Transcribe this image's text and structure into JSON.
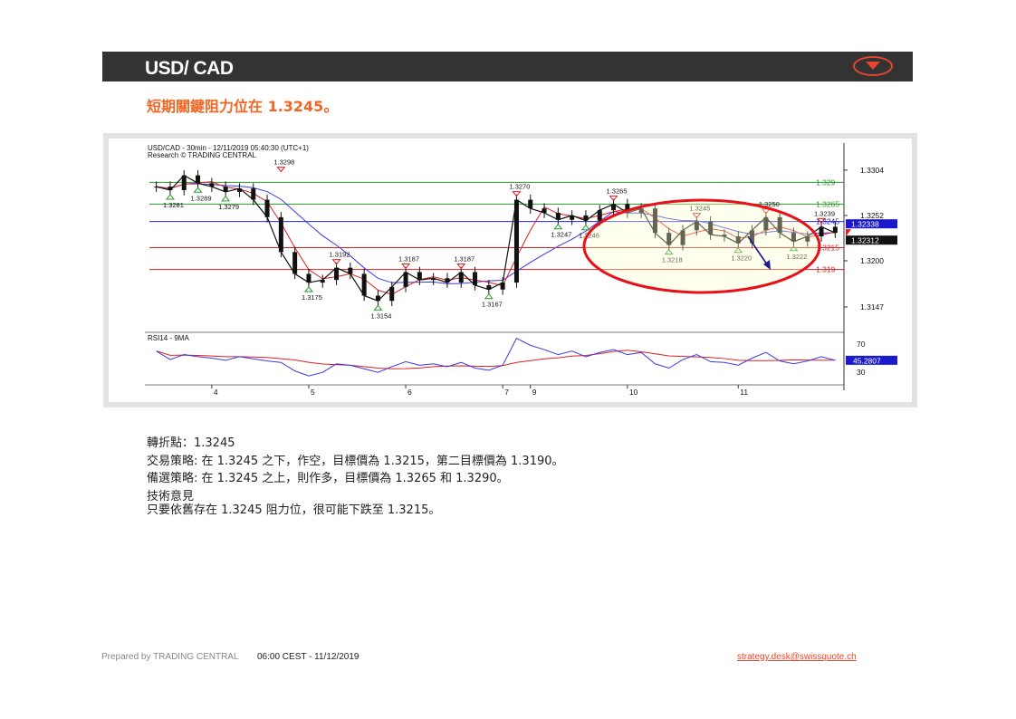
{
  "header": {
    "title": "USD/ CAD"
  },
  "headline": "短期關鍵阻力位在 1.3245。",
  "chart_data": {
    "type": "line",
    "title": "USD/CAD - 30min - 12/11/2019 05:40:30 (UTC+1)",
    "subtitle": "Research © TRADING CENTRAL",
    "x_ticks": [
      "4",
      "5",
      "6",
      "7",
      "9",
      "10",
      "11"
    ],
    "y_ticks": [
      1.3304,
      1.3252,
      1.32,
      1.3147
    ],
    "ylim": [
      1.312,
      1.3335
    ],
    "series": [
      {
        "values": [
          1.3285,
          1.3281,
          1.3298,
          1.3289,
          1.3285,
          1.3279,
          1.3283,
          1.327,
          1.325,
          1.321,
          1.3185,
          1.3175,
          1.3178,
          1.3192,
          1.3185,
          1.316,
          1.3154,
          1.317,
          1.3187,
          1.3178,
          1.318,
          1.3175,
          1.3187,
          1.3172,
          1.3167,
          1.3175,
          1.327,
          1.326,
          1.3255,
          1.3247,
          1.3252,
          1.3246,
          1.3258,
          1.3265,
          1.3255,
          1.326,
          1.3232,
          1.3218,
          1.3235,
          1.3245,
          1.323,
          1.3228,
          1.322,
          1.3235,
          1.325,
          1.3232,
          1.3222,
          1.3228,
          1.3239,
          1.3232
        ]
      }
    ],
    "horizontal_levels": [
      {
        "label": "1.329",
        "value": 1.329,
        "color": "#2a9a2a"
      },
      {
        "label": "1.3265",
        "value": 1.3265,
        "color": "#2a9a2a"
      },
      {
        "label": "1.3245",
        "value": 1.3245,
        "color": "#2626d0"
      },
      {
        "label": "1.3215",
        "value": 1.3215,
        "color": "#e02020"
      },
      {
        "label": "1.319",
        "value": 1.319,
        "color": "#e02020"
      }
    ],
    "current_prices": [
      {
        "label": "1.32338",
        "color": "#1a1acc"
      },
      {
        "label": "1.32312",
        "color": "#111111"
      }
    ],
    "annotations": [
      {
        "text": "1.3298",
        "x": 9,
        "y": 1.3298,
        "kind": "high"
      },
      {
        "text": "1.3281",
        "x": 1,
        "y": 1.3281,
        "kind": "low"
      },
      {
        "text": "1.3289",
        "x": 3,
        "y": 1.3289,
        "kind": "low"
      },
      {
        "text": "1.3279",
        "x": 5,
        "y": 1.3279,
        "kind": "low"
      },
      {
        "text": "1.3192",
        "x": 13,
        "y": 1.3192,
        "kind": "high"
      },
      {
        "text": "1.3187",
        "x": 18,
        "y": 1.3187,
        "kind": "high"
      },
      {
        "text": "1.3175",
        "x": 11,
        "y": 1.3175,
        "kind": "low"
      },
      {
        "text": "1.3154",
        "x": 16,
        "y": 1.3154,
        "kind": "low"
      },
      {
        "text": "1.3187",
        "x": 22,
        "y": 1.3187,
        "kind": "high"
      },
      {
        "text": "1.3167",
        "x": 24,
        "y": 1.3167,
        "kind": "low"
      },
      {
        "text": "1.3270",
        "x": 26,
        "y": 1.327,
        "kind": "high"
      },
      {
        "text": "1.3247",
        "x": 29,
        "y": 1.3247,
        "kind": "low"
      },
      {
        "text": "1.3246",
        "x": 31,
        "y": 1.3246,
        "kind": "low"
      },
      {
        "text": "1.3265",
        "x": 33,
        "y": 1.3265,
        "kind": "high"
      },
      {
        "text": "1.3218",
        "x": 37,
        "y": 1.3218,
        "kind": "low"
      },
      {
        "text": "1.3245",
        "x": 39,
        "y": 1.3245,
        "kind": "high"
      },
      {
        "text": "1.3220",
        "x": 42,
        "y": 1.322,
        "kind": "low"
      },
      {
        "text": "1.3250",
        "x": 44,
        "y": 1.325,
        "kind": "high"
      },
      {
        "text": "1.3222",
        "x": 46,
        "y": 1.3222,
        "kind": "low"
      },
      {
        "text": "1.3239",
        "x": 48,
        "y": 1.3239,
        "kind": "high"
      }
    ],
    "indicator": {
      "title": "RSI14 - 9MA",
      "y_ticks": [
        70,
        30
      ],
      "ylim": [
        15,
        85
      ],
      "current_values": [
        {
          "label": "45.2807",
          "color": "#1a1acc"
        }
      ],
      "values": [
        60,
        48,
        55,
        52,
        50,
        47,
        52,
        49,
        46,
        44,
        32,
        25,
        30,
        42,
        40,
        35,
        30,
        38,
        45,
        40,
        42,
        38,
        44,
        36,
        33,
        40,
        78,
        68,
        62,
        55,
        60,
        52,
        58,
        62,
        55,
        58,
        42,
        36,
        48,
        55,
        45,
        44,
        40,
        50,
        58,
        46,
        42,
        46,
        52,
        47
      ]
    },
    "colors": {
      "price": "#111111",
      "ma_fast": "#e02020",
      "ma_slow": "#3a3ae0",
      "highlight_ellipse": "#e8101a",
      "arrow": "#1a1a88"
    }
  },
  "analysis": {
    "pivot": "轉折點：1.3245",
    "strategy": "交易策略: 在 1.3245 之下，作空，目標價為 1.3215，第二目標價為 1.3190。",
    "alternative": "備選策略: 在 1.3245 之上，則作多，目標價為 1.3265 和 1.3290。",
    "comment_title": "技術意見",
    "comment": "只要依舊存在 1.3245 阻力位，很可能下跌至 1.3215。"
  },
  "footer": {
    "prepared_by": "Prepared by TRADING CENTRAL",
    "time": "06:00 CEST - 11/12/2019",
    "email": "strategy.desk@swissquote.ch"
  }
}
